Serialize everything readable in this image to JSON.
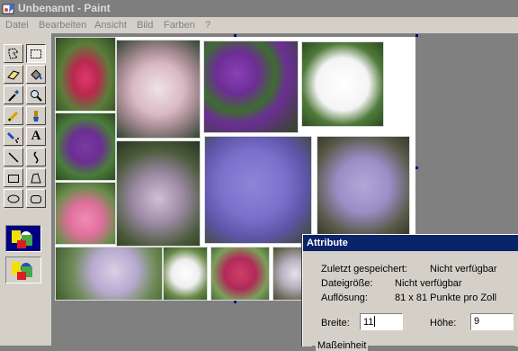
{
  "window": {
    "title": "Unbenannt - Paint",
    "icon": "paint-app-icon"
  },
  "menu": {
    "items": [
      "Datei",
      "Bearbeiten",
      "Ansicht",
      "Bild",
      "Farben",
      "?"
    ]
  },
  "tools": [
    {
      "name": "free-select-icon"
    },
    {
      "name": "rect-select-icon"
    },
    {
      "name": "eraser-icon"
    },
    {
      "name": "fill-bucket-icon"
    },
    {
      "name": "color-picker-icon"
    },
    {
      "name": "magnifier-icon"
    },
    {
      "name": "pencil-icon"
    },
    {
      "name": "brush-icon"
    },
    {
      "name": "airbrush-icon"
    },
    {
      "name": "text-icon",
      "glyph": "A"
    },
    {
      "name": "line-icon"
    },
    {
      "name": "curve-icon"
    },
    {
      "name": "rectangle-icon"
    },
    {
      "name": "polygon-icon"
    },
    {
      "name": "ellipse-icon"
    },
    {
      "name": "rounded-rect-icon"
    }
  ],
  "dialog": {
    "title": "Attribute",
    "saved_label": "Zuletzt gespeichert:",
    "saved_value": "Nicht verfügbar",
    "size_label": "Dateigröße:",
    "size_value": "Nicht verfügbar",
    "resolution_label": "Auflösung:",
    "resolution_value": "81 x 81 Punkte pro Zoll",
    "width_label": "Breite:",
    "width_value": "11",
    "height_label": "Höhe:",
    "height_value": "9",
    "unit_group_label": "Maßeinheit"
  },
  "colors": {
    "titlebar": "#7f7f7f",
    "dialog_title": "#0a246a",
    "face": "#d4d0c8",
    "workspace": "#808080"
  }
}
